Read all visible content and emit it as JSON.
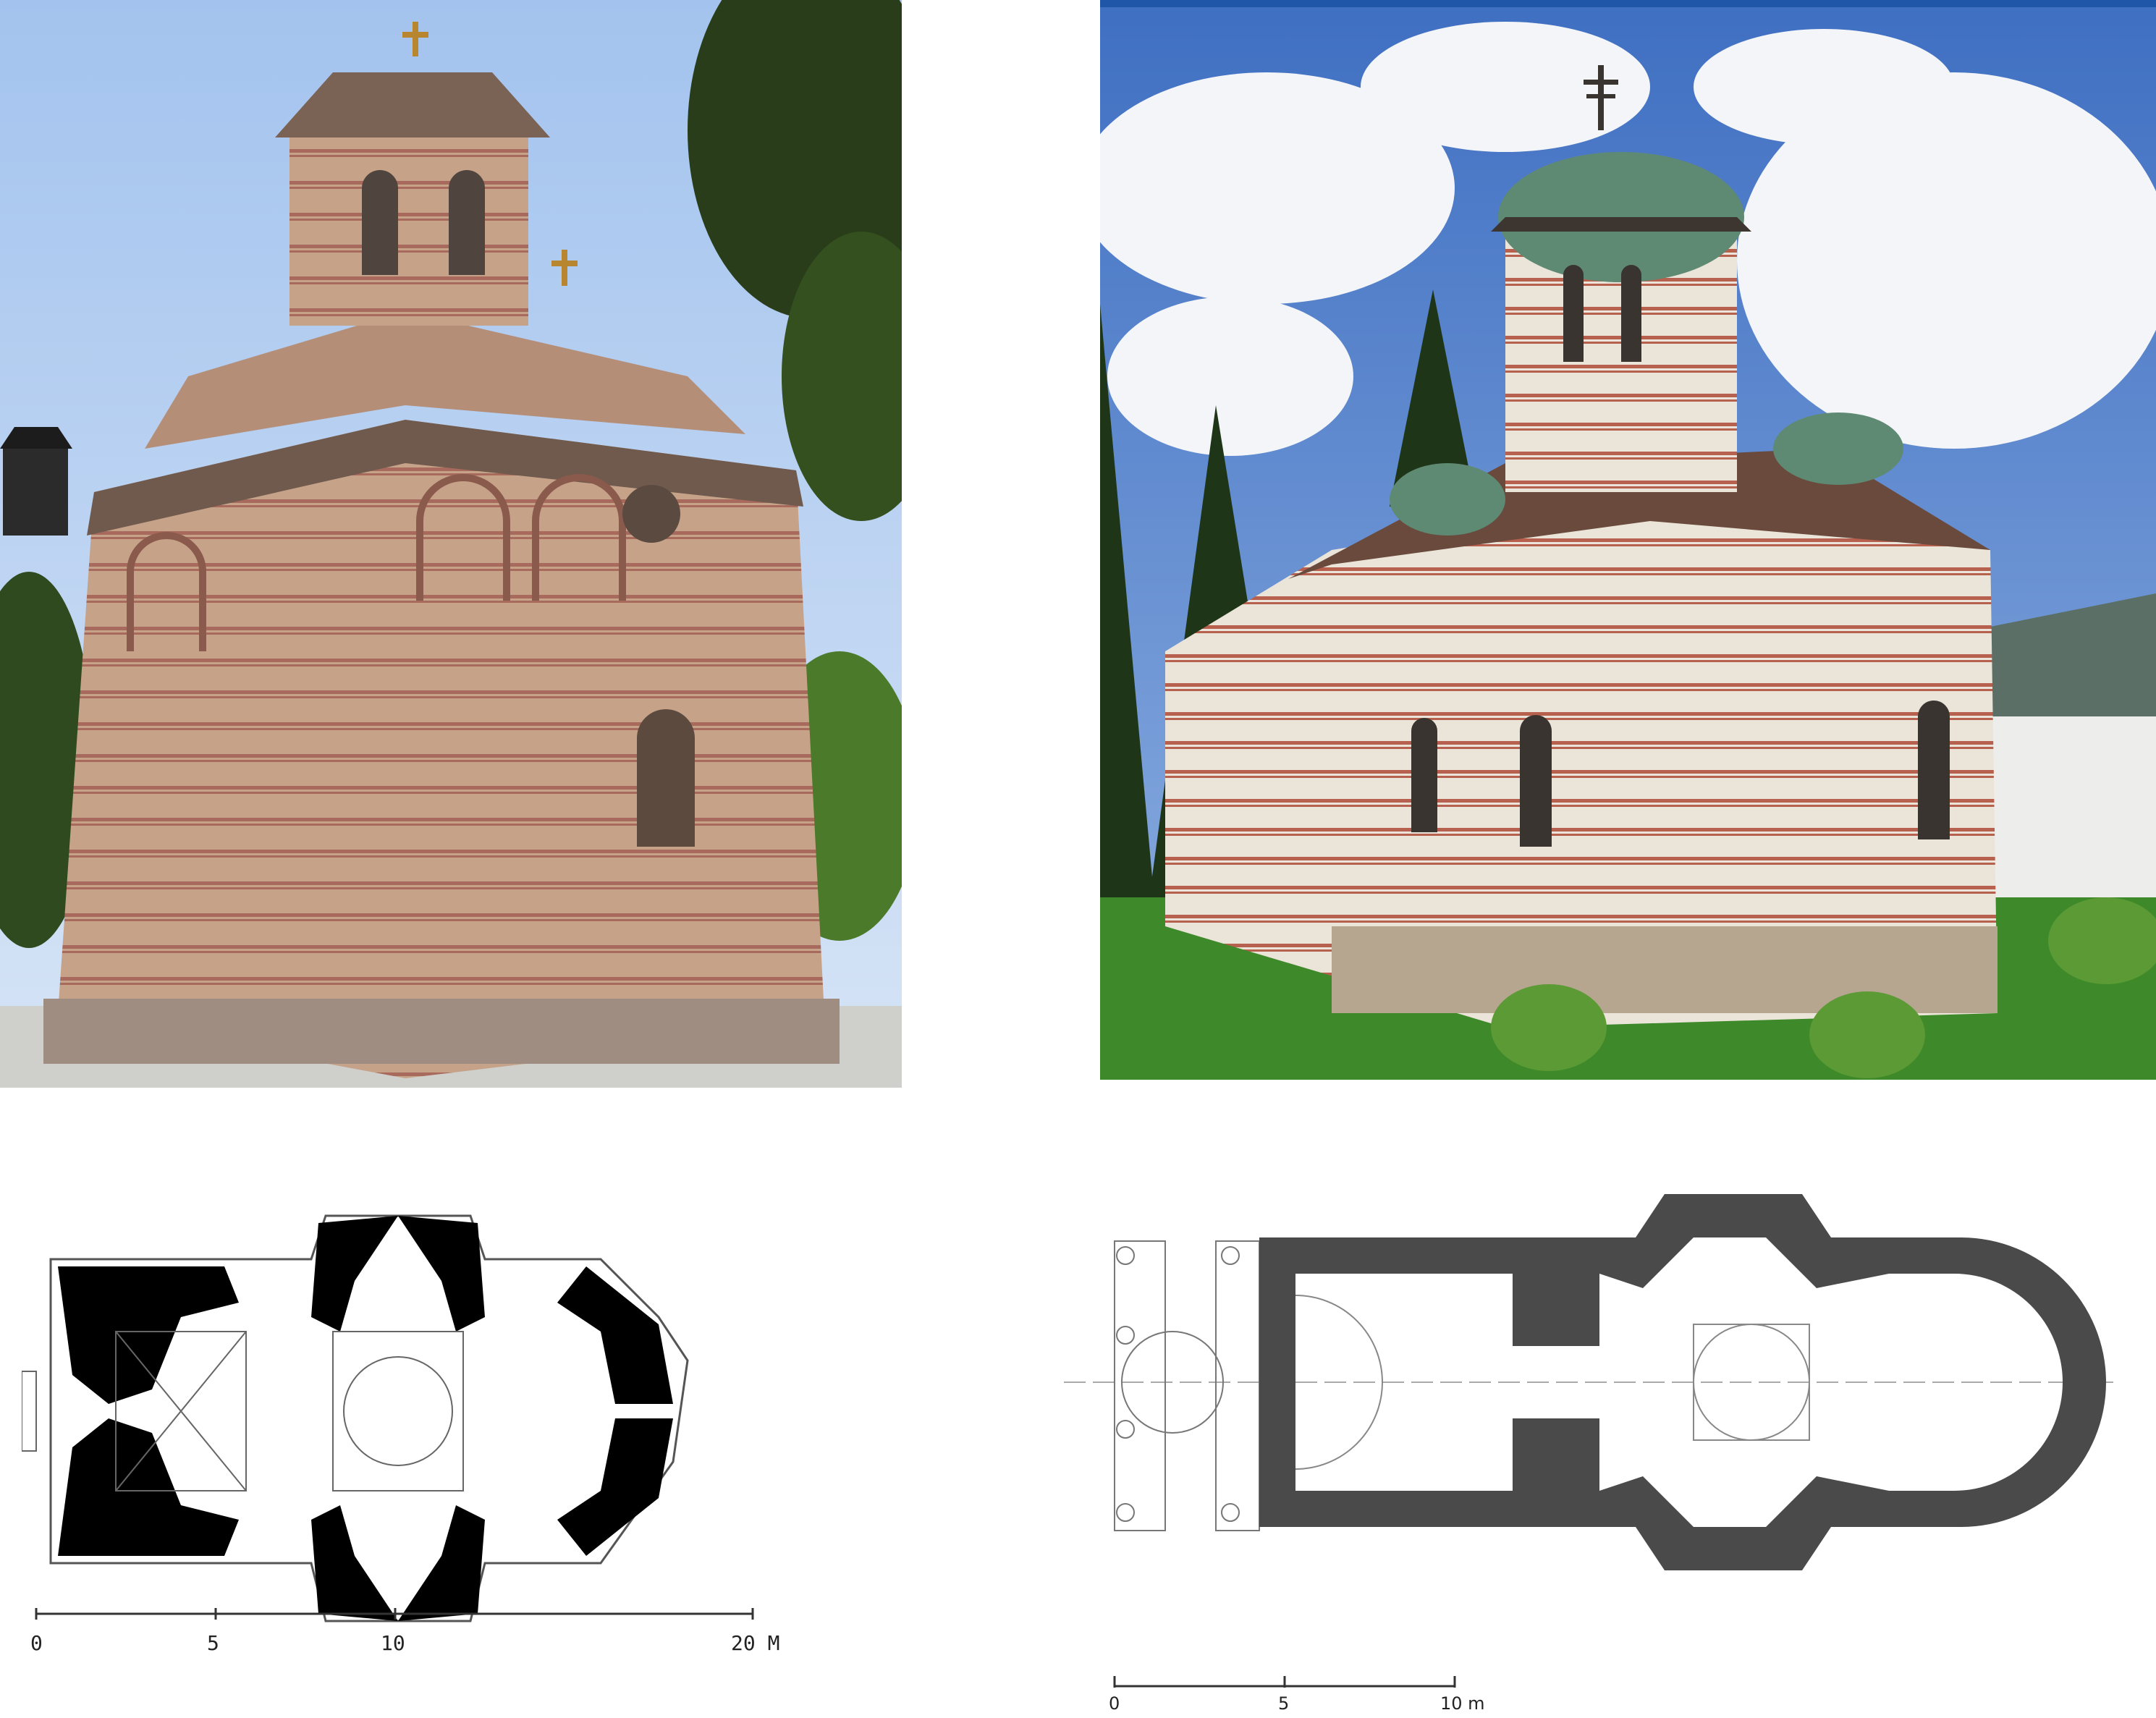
{
  "left_plan": {
    "scale_labels": [
      "0",
      "5",
      "10",
      "20 M"
    ]
  },
  "right_plan": {
    "scale_labels": [
      "0",
      "5",
      "10 m"
    ]
  },
  "colors": {
    "sky_left": "#a9c6ec",
    "stone": "#c7a48a",
    "brick_band": "#a8645a",
    "sky_right": "#4a78c8",
    "cloud": "#f2f4f8",
    "dome_green": "#5e8a74",
    "plaster": "#e8e2d6",
    "foliage": "#2f4a1e",
    "grass": "#3f8a2a",
    "plan_black": "#000000",
    "plan_grey": "#4a4a4a",
    "top_rule": "#1f56a8"
  }
}
